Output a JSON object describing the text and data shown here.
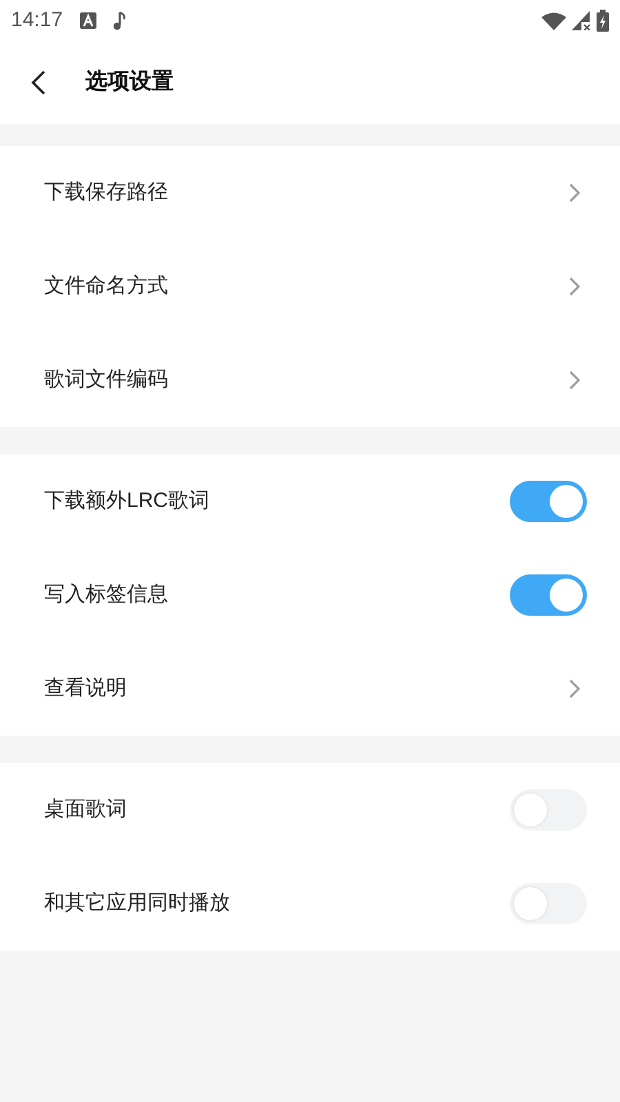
{
  "status_bar": {
    "time": "14:17"
  },
  "header": {
    "title": "选项设置"
  },
  "sections": [
    {
      "items": [
        {
          "kind": "link",
          "label": "下载保存路径"
        },
        {
          "kind": "link",
          "label": "文件命名方式"
        },
        {
          "kind": "link",
          "label": "歌词文件编码"
        }
      ]
    },
    {
      "items": [
        {
          "kind": "toggle",
          "label": "下载额外LRC歌词",
          "on": true
        },
        {
          "kind": "toggle",
          "label": "写入标签信息",
          "on": true
        },
        {
          "kind": "link",
          "label": "查看说明"
        }
      ]
    },
    {
      "items": [
        {
          "kind": "toggle",
          "label": "桌面歌词",
          "on": false
        },
        {
          "kind": "toggle",
          "label": "和其它应用同时播放",
          "on": false
        }
      ]
    }
  ]
}
